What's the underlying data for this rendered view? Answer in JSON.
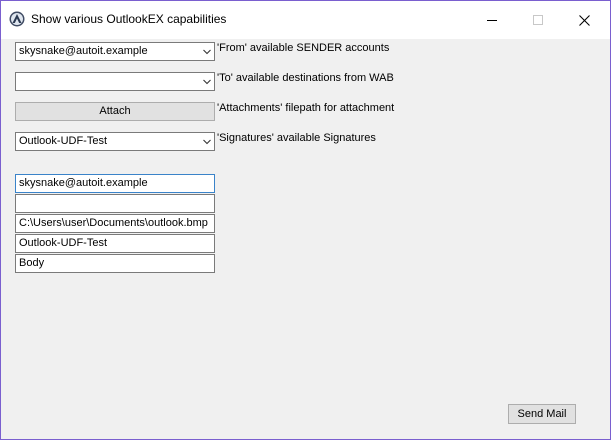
{
  "window": {
    "title": "Show various OutlookEX capabilities",
    "icon": "autoit-icon",
    "controls": {
      "minimize": "minimize-icon",
      "maximize": "maximize-icon",
      "close": "close-icon"
    }
  },
  "from": {
    "value": "skysnake@autoit.example",
    "label": "'From' available SENDER accounts"
  },
  "to": {
    "value": "",
    "label": "'To' available destinations from WAB"
  },
  "attachments": {
    "button_label": "Attach",
    "label": "'Attachments' filepath for attachment"
  },
  "signatures": {
    "value": "Outlook-UDF-Test",
    "label": "'Signatures' available Signatures"
  },
  "fields": [
    {
      "value": "skysnake@autoit.example"
    },
    {
      "value": ""
    },
    {
      "value": "C:\\Users\\user\\Documents\\outlook.bmp"
    },
    {
      "value": "Outlook-UDF-Test"
    },
    {
      "value": "Body"
    }
  ],
  "send": {
    "label": "Send Mail"
  },
  "colors": {
    "frame": "#7a5fcf",
    "client_bg": "#f0f0f0",
    "focus_border": "#3a83c9"
  }
}
